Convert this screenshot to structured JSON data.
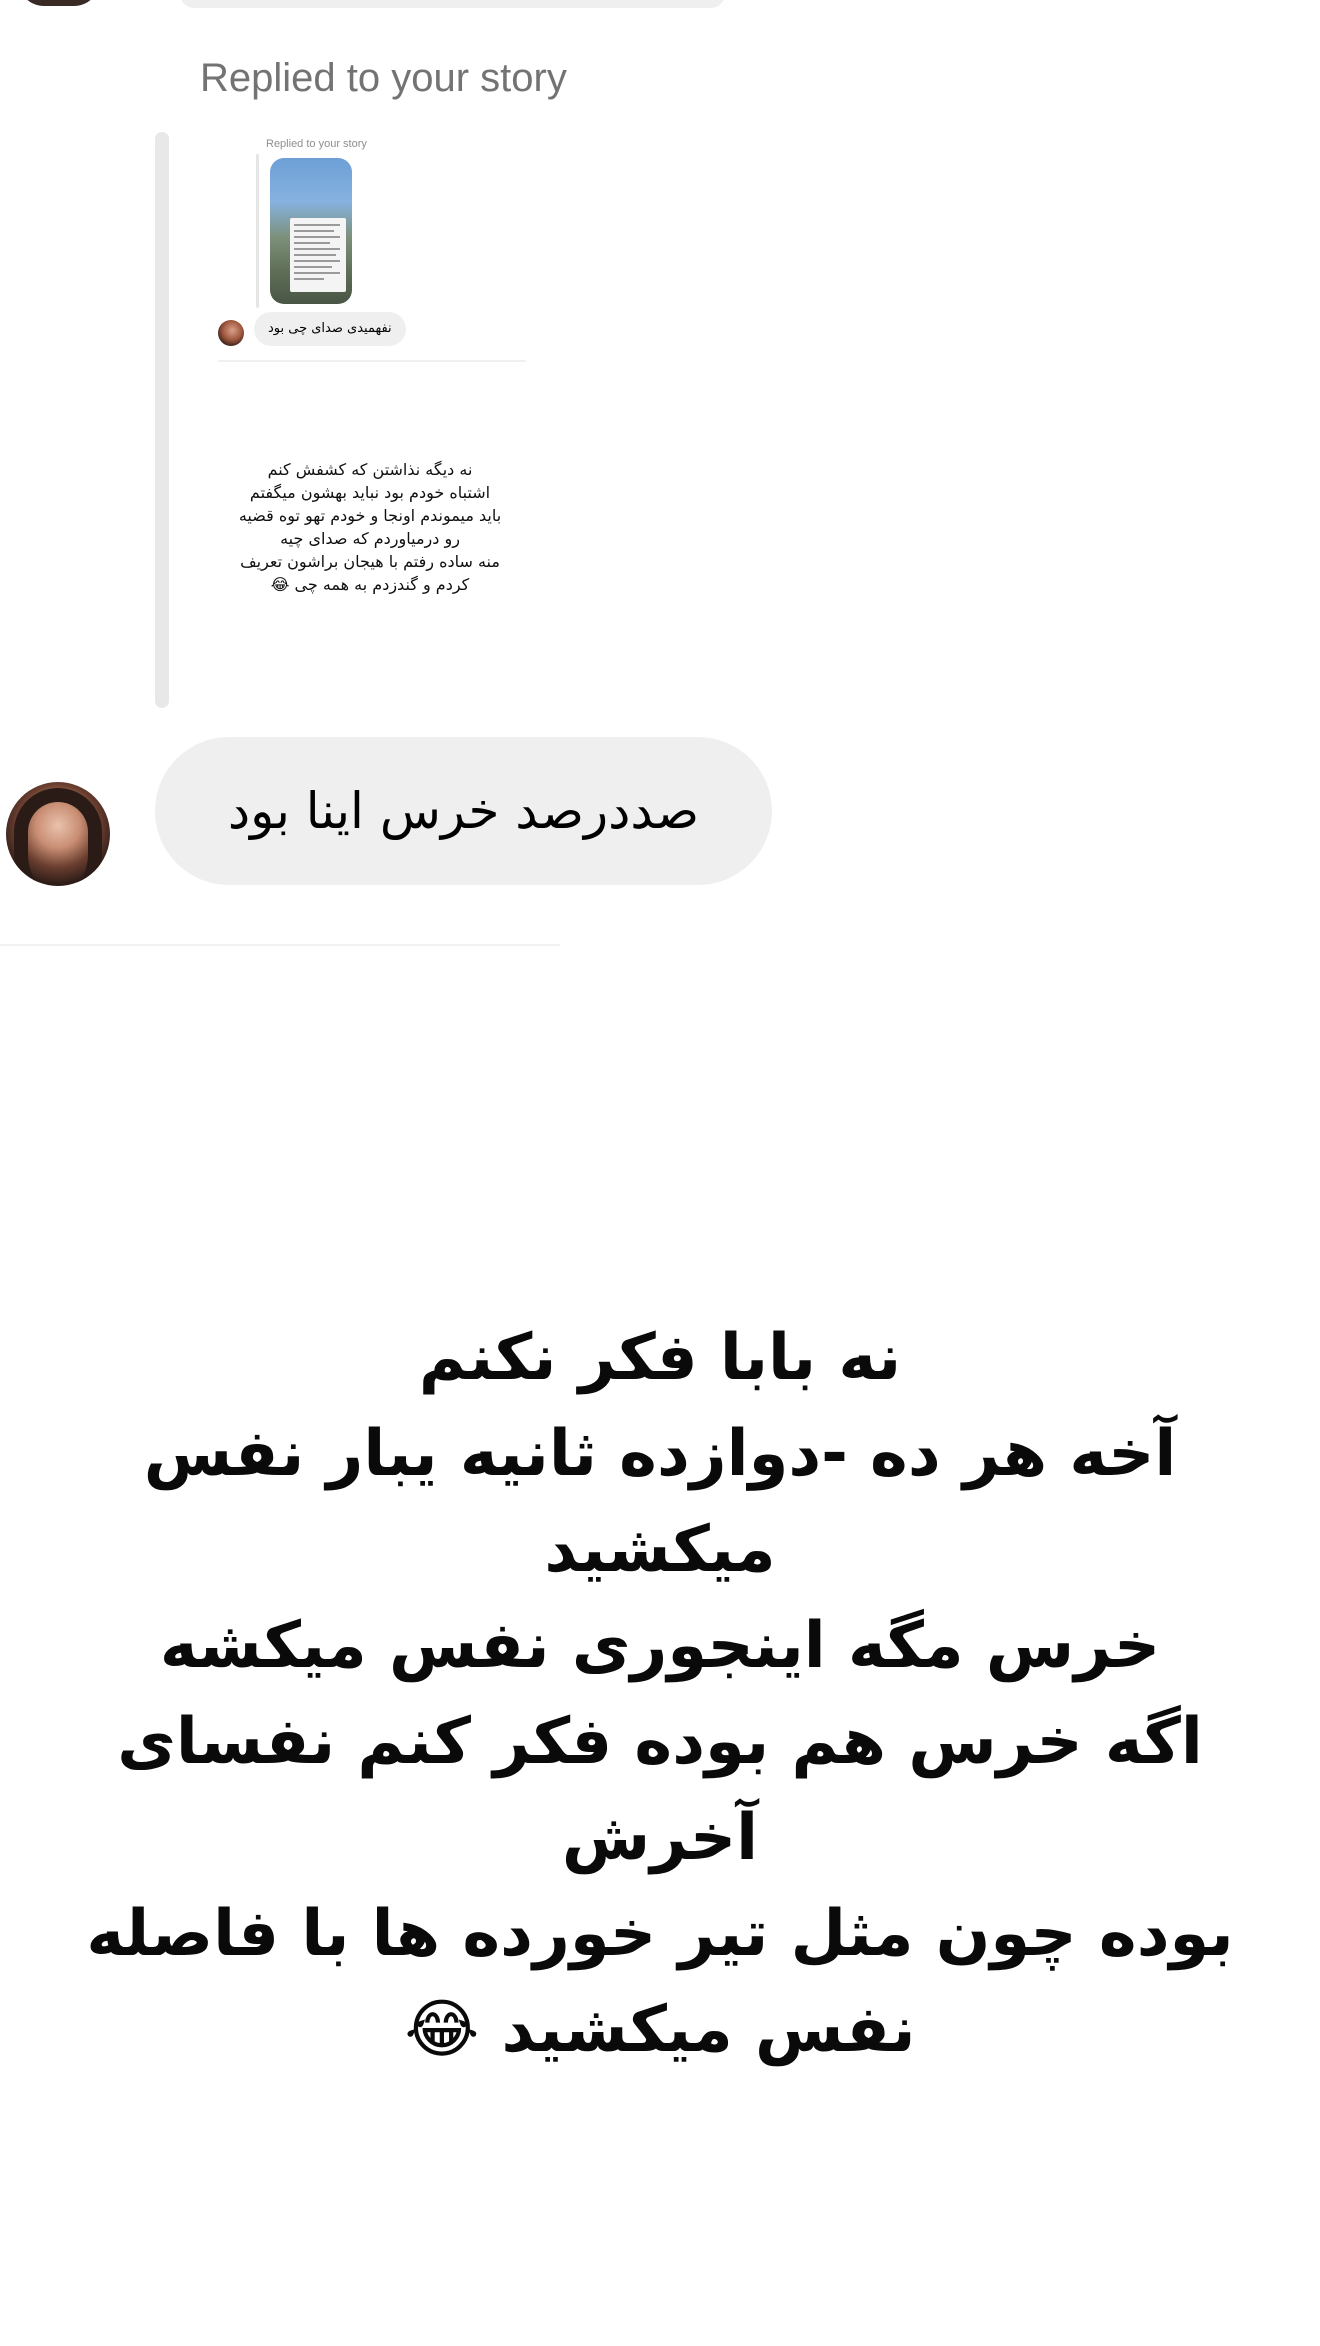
{
  "thread": {
    "replied_label": "Replied to your story",
    "story_preview": {
      "replied_label": "Replied to your story",
      "bubble_text": "نفهمیدی صدای چی بود",
      "post_text": "نه دیگه نذاشتن که کشفش کنم\nاشتباه خودم بود نباید بهشون میگفتم\nباید میموندم اونجا و خودم تهو توه قضیه\nرو درمیاوردم که صدای چیه\nمنه ساده رفتم با هیجان براشون تعریف\nکردم و گندزدم به همه چی 😂"
    },
    "message": {
      "text": "صددرصد خرس اینا بود"
    }
  },
  "caption": {
    "text": "نه بابا فکر نکنم\nآخه هر ده -دوازده ثانیه یبار نفس میکشید\nخرس مگه اینجوری نفس میکشه\nاگه خرس هم بوده فکر کنم نفسای آخرش\nبوده چون مثل تیر خورده ها با فاصله\nنفس میکشید 😂"
  },
  "colors": {
    "bubble_bg": "#efefef",
    "label_gray": "#737373",
    "page_bg": "#ffffff"
  },
  "icons": {
    "sender_avatar": "profile-photo",
    "mini_avatar": "profile-photo"
  }
}
